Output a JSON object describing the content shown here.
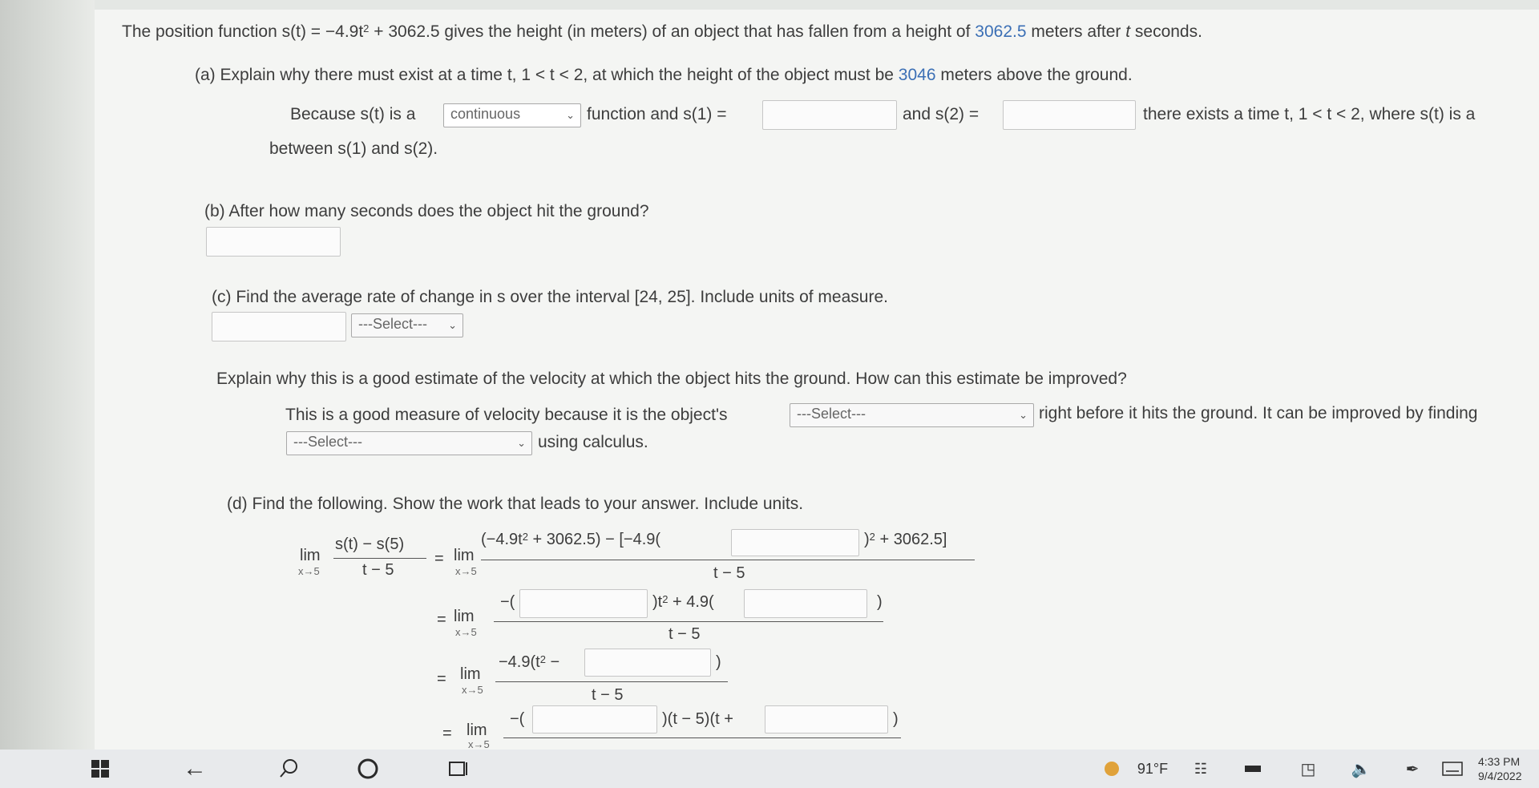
{
  "problem": {
    "intro_1": "The position function s(t) = −4.9t",
    "intro_sup": "2",
    "intro_2": " + 3062.5 gives the height (in meters) of an object that has fallen from a height of ",
    "intro_height": "3062.5",
    "intro_3": " meters after ",
    "intro_t": "t",
    "intro_4": " seconds."
  },
  "part_a": {
    "question_1": "(a) Explain why there must exist at a time t, 1 < t < 2, at which the height of the object must be ",
    "question_value": "3046",
    "question_2": " meters above the ground.",
    "because": "Because s(t) is a",
    "continuous_selected": "continuous",
    "function_and": "function and s(1) =",
    "and_s2": "and s(2) =",
    "there_exists": "there exists a time t, 1 < t < 2, where s(t) is a",
    "between": "between s(1) and s(2)."
  },
  "part_b": {
    "question": "(b) After how many seconds does the object hit the ground?"
  },
  "part_c": {
    "question": "(c) Find the average rate of change in s over the interval [24, 25]. Include units of measure.",
    "units_select": "---Select---",
    "explain": "Explain why this is a good estimate of the velocity at which the object hits the ground. How can this estimate be improved?",
    "measure_text": "This is a good measure of velocity because it is the object's",
    "select_1": "---Select---",
    "right_before": "right before it hits the ground. It can be improved by finding",
    "select_2": "---Select---",
    "using_calculus": "using calculus."
  },
  "part_d": {
    "question": "(d) Find the following. Show the work that leads to your answer. Include units.",
    "lim": "lim",
    "lim_sub": "x→5",
    "lhs_num": "s(t) − s(5)",
    "lhs_den": "t − 5",
    "eq": "=",
    "l1_num_a": "(−4.9t",
    "l1_num_b": " + 3062.5) − [−4.9(",
    "l1_num_c": ")",
    "l1_num_d": " + 3062.5]",
    "sq": "2",
    "t_minus_5": "t − 5",
    "l2_a": "−(",
    "l2_b": ")t",
    "l2_c": " + 4.9(",
    "l2_d": ")",
    "l3_a": "−4.9(t",
    "l3_b": " −",
    "l3_c": ")",
    "l4_a": "−(",
    "l4_b": ")(t − 5)(t +",
    "l4_c": ")"
  },
  "taskbar": {
    "temperature": "91°F",
    "time": "4:33 PM",
    "date": "9/4/2022"
  },
  "colors": {
    "highlight": "#3b6fb5",
    "text": "#3d3d3d",
    "taskbar": "#e8eaec"
  }
}
